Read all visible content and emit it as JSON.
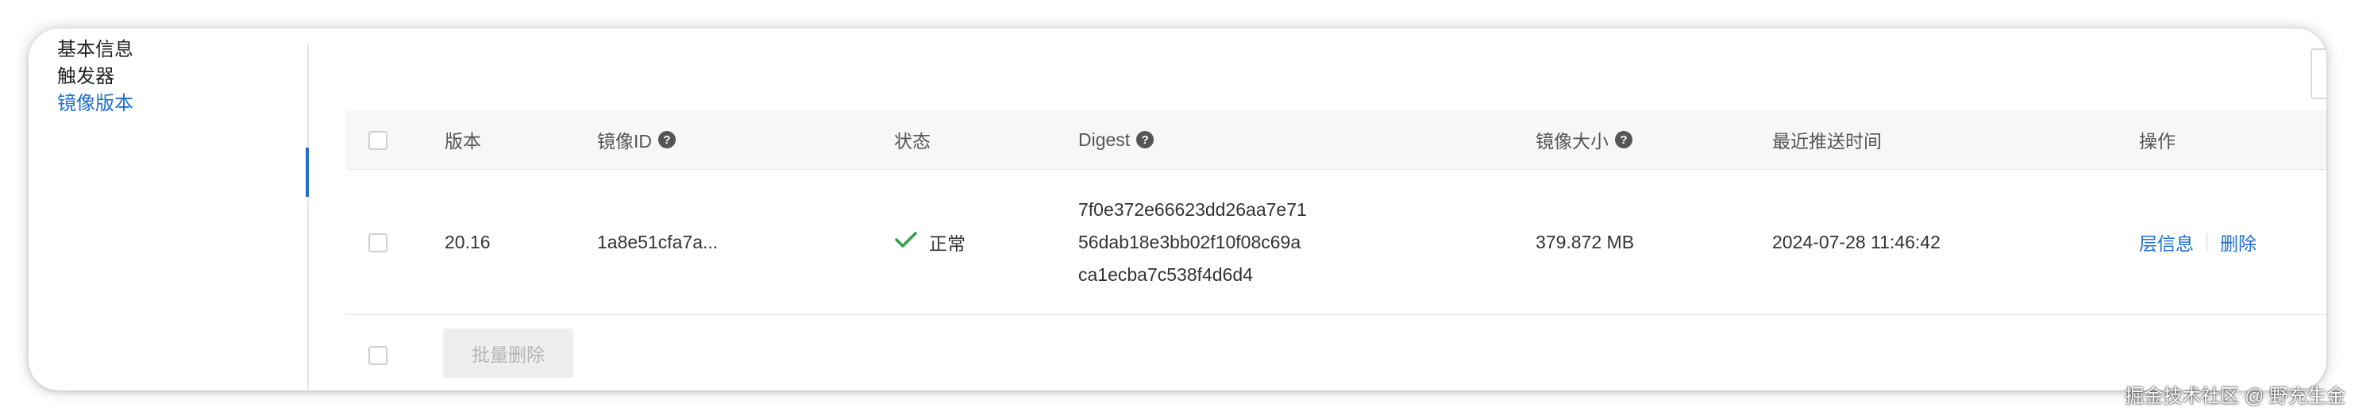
{
  "sidebar": {
    "items": [
      {
        "label": "基本信息"
      },
      {
        "label": "触发器"
      },
      {
        "label": "镜像版本"
      }
    ],
    "active_index": 2
  },
  "table": {
    "columns": {
      "version": "版本",
      "image_id": "镜像ID",
      "status": "状态",
      "digest": "Digest",
      "size": "镜像大小",
      "last_push": "最近推送时间",
      "actions": "操作"
    },
    "rows": [
      {
        "version": "20.16",
        "image_id": "1a8e51cfa7a...",
        "status": "正常",
        "digest_lines": [
          "7f0e372e66623dd26aa7e71",
          "56dab18e3bb02f10f08c69a",
          "ca1ecba7c538f4d6d4"
        ],
        "size": "379.872 MB",
        "last_push": "2024-07-28 11:46:42",
        "action_layers": "层信息",
        "action_delete": "删除"
      }
    ]
  },
  "footer": {
    "batch_delete": "批量删除"
  },
  "icons": {
    "help": "help-circle-icon",
    "status_ok": "check-icon"
  },
  "colors": {
    "accent": "#1f6fd0",
    "status_ok": "#2ea04a"
  },
  "watermark": "掘金技术社区 @ 野充生金"
}
